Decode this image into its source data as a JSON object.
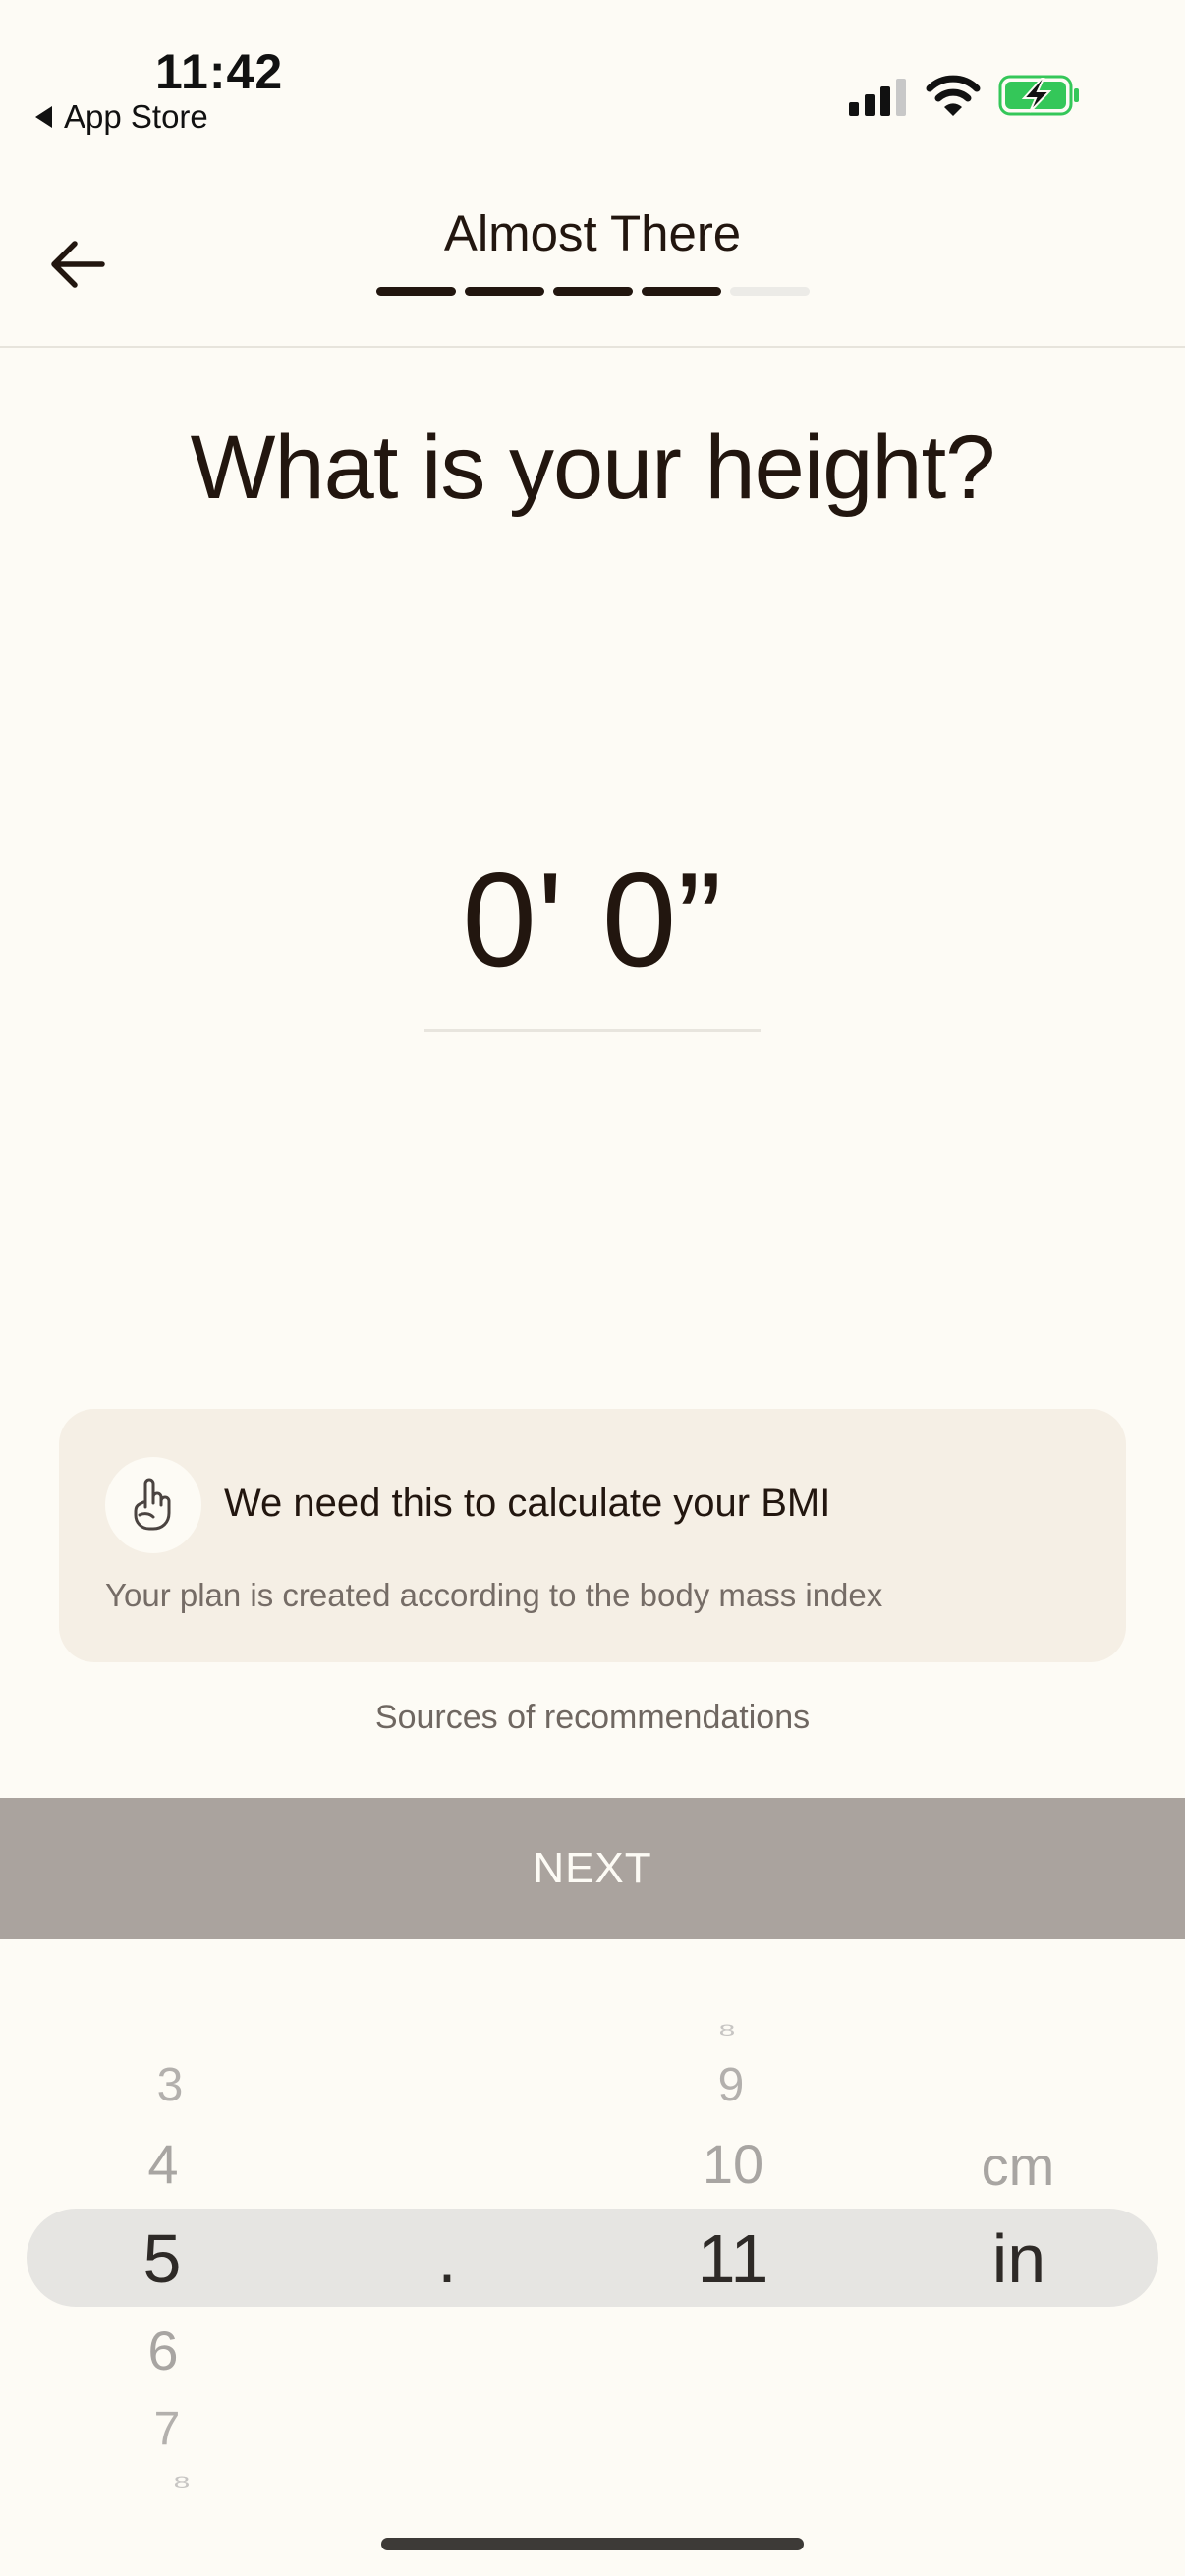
{
  "status_bar": {
    "time": "11:42",
    "back_app": "App Store",
    "battery_color": "#34c759"
  },
  "header": {
    "title": "Almost There",
    "progress": {
      "completed": 4,
      "total": 5
    }
  },
  "question": "What is your height?",
  "value_display": "0' 0”",
  "info_card": {
    "icon": "pointing-hand-icon",
    "title": "We need this to calculate your BMI",
    "subtitle": "Your plan is created according to the body mass index"
  },
  "sources_link": "Sources of recommendations",
  "next_button": "NEXT",
  "picker": {
    "feet": {
      "above": [
        "3",
        "4"
      ],
      "selected": "5",
      "below": [
        "6",
        "7",
        "8"
      ]
    },
    "separator": ".",
    "inches": {
      "above": [
        "8",
        "9",
        "10"
      ],
      "selected": "11"
    },
    "units": {
      "above": [
        "cm"
      ],
      "selected": "in"
    }
  },
  "colors": {
    "background": "#fdfbf5",
    "text": "#22160f",
    "card": "#f5efe5",
    "button_disabled": "#aaa39e",
    "picker_highlight": "#e6e5e2"
  }
}
